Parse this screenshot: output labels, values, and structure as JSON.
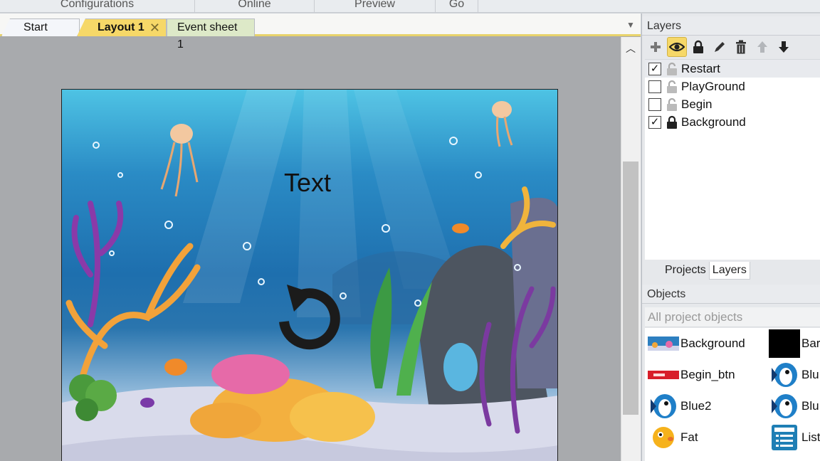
{
  "ribbon": {
    "groups": [
      "Configurations",
      "Online",
      "Preview",
      "Go"
    ]
  },
  "tabs": [
    {
      "label": "Start page"
    },
    {
      "label": "Layout 1",
      "close": "✕"
    },
    {
      "label": "Event sheet 1"
    }
  ],
  "canvas": {
    "text": "Text"
  },
  "layers_panel": {
    "title": "Layers",
    "tools": [
      "add-icon",
      "eye-icon",
      "lock-icon",
      "pencil-icon",
      "trash-icon",
      "arrow-up-icon",
      "arrow-down-icon"
    ],
    "items": [
      {
        "label": "Restart",
        "checked": "✓",
        "locked": false
      },
      {
        "label": "PlayGround",
        "checked": "",
        "locked": false
      },
      {
        "label": "Begin",
        "checked": "",
        "locked": false
      },
      {
        "label": "Background",
        "checked": "✓",
        "locked": true
      }
    ],
    "subtabs": [
      "Projects",
      "Layers"
    ]
  },
  "objects_panel": {
    "title": "Objects",
    "filter_placeholder": "All project objects",
    "items": [
      {
        "label": "Background",
        "icon": "background-thumbnail-icon"
      },
      {
        "label": "Bar",
        "icon": "black-square-icon"
      },
      {
        "label": "Begin_btn",
        "icon": "red-button-icon"
      },
      {
        "label": "Blu",
        "icon": "blue-fish-icon"
      },
      {
        "label": "Blue2",
        "icon": "blue-fish-icon"
      },
      {
        "label": "Blu",
        "icon": "blue-fish-icon"
      },
      {
        "label": "Fat",
        "icon": "yellow-fish-icon"
      },
      {
        "label": "List",
        "icon": "list-icon"
      }
    ]
  },
  "colors": {
    "active_tab": "#f6d868",
    "event_tab": "#dde9c8",
    "panel_bg": "#e6e8eb"
  }
}
